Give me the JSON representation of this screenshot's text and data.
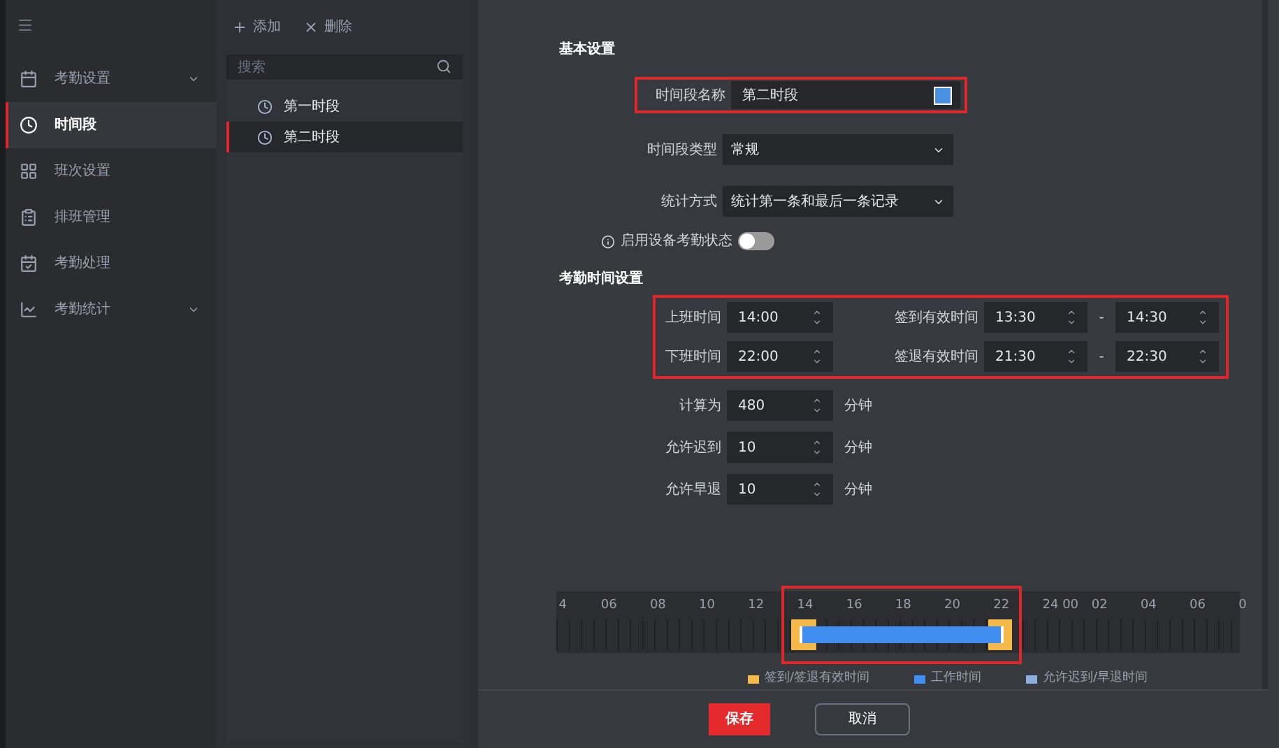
{
  "sidebar": {
    "items": [
      {
        "label": "考勤设置",
        "selected": false,
        "expandable": true
      },
      {
        "label": "时间段",
        "selected": true,
        "expandable": false
      },
      {
        "label": "班次设置",
        "selected": false,
        "expandable": false
      },
      {
        "label": "排班管理",
        "selected": false,
        "expandable": false
      },
      {
        "label": "考勤处理",
        "selected": false,
        "expandable": false
      },
      {
        "label": "考勤统计",
        "selected": false,
        "expandable": true
      }
    ]
  },
  "toolbar": {
    "add": "添加",
    "delete": "删除"
  },
  "search": {
    "placeholder": "搜索"
  },
  "periods": [
    {
      "label": "第一时段",
      "selected": false
    },
    {
      "label": "第二时段",
      "selected": true
    }
  ],
  "basic": {
    "title": "基本设置",
    "name": {
      "label": "时间段名称",
      "value": "第二时段",
      "color": "#4a90e2"
    },
    "type": {
      "label": "时间段类型",
      "value": "常规"
    },
    "method": {
      "label": "统计方式",
      "value": "统计第一条和最后一条记录"
    },
    "device_status": {
      "label": "启用设备考勤状态",
      "on": false
    }
  },
  "attendance": {
    "title": "考勤时间设置",
    "start": {
      "label": "上班时间",
      "value": "14:00",
      "window_label": "签到有效时间",
      "from": "13:30",
      "to": "14:30"
    },
    "end": {
      "label": "下班时间",
      "value": "22:00",
      "window_label": "签退有效时间",
      "from": "21:30",
      "to": "22:30"
    },
    "separator": "-",
    "minutes": [
      {
        "label": "计算为",
        "value": "480",
        "unit": "分钟"
      },
      {
        "label": "允许迟到",
        "value": "10",
        "unit": "分钟"
      },
      {
        "label": "允许早退",
        "value": "10",
        "unit": "分钟"
      }
    ]
  },
  "timeline": {
    "labels": [
      "4",
      "06",
      "08",
      "10",
      "12",
      "14",
      "16",
      "18",
      "20",
      "22",
      "24 00",
      "02",
      "04",
      "06",
      "0"
    ],
    "legend": [
      "签到/签退有效时间",
      "工作时间",
      "允许迟到/早退时间"
    ]
  },
  "buttons": {
    "save": "保存",
    "cancel": "取消"
  }
}
